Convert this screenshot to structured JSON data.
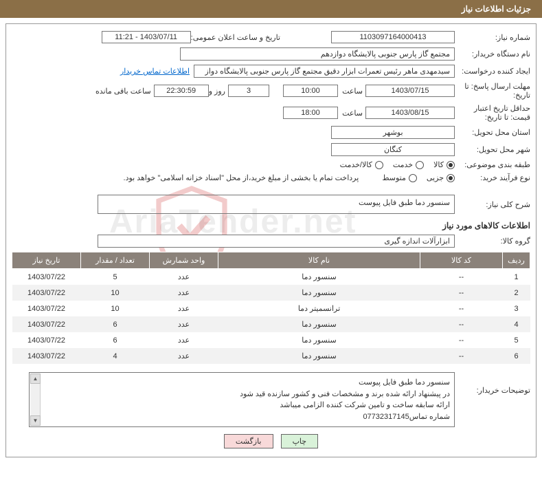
{
  "header": {
    "title": "جزئیات اطلاعات نیاز"
  },
  "labels": {
    "need_no": "شماره نیاز:",
    "announce_date": "تاریخ و ساعت اعلان عمومی:",
    "buyer_name": "نام دستگاه خریدار:",
    "requester": "ایجاد کننده درخواست:",
    "contact_link": "اطلاعات تماس خریدار",
    "response_deadline": "مهلت ارسال پاسخ: تا تاریخ:",
    "hour": "ساعت",
    "days_and": "روز و",
    "remaining": "ساعت باقی مانده",
    "min_valid": "حداقل تاریخ اعتبار قیمت: تا تاریخ:",
    "province": "استان محل تحویل:",
    "city": "شهر محل تحویل:",
    "classify": "طبقه بندی موضوعی:",
    "goods": "کالا",
    "service": "خدمت",
    "goods_service": "کالا/خدمت",
    "process": "نوع فرآیند خرید:",
    "partial": "جزیی",
    "medium": "متوسط",
    "payment_note": "پرداخت تمام یا بخشی از مبلغ خرید،از محل \"اسناد خزانه اسلامی\" خواهد بود.",
    "overall": "شرح کلی نیاز:",
    "goods_info": "اطلاعات کالاهای مورد نیاز",
    "group": "گروه کالا:",
    "buyer_desc": "توضیحات خریدار:",
    "print": "چاپ",
    "back": "بازگشت"
  },
  "values": {
    "need_no": "1103097164000413",
    "announce_date": "1403/07/11 - 11:21",
    "buyer_name": "مجتمع گاز پارس جنوبی  پالایشگاه دوازدهم",
    "requester": "سیدمهدی ماهر رئیس تعمرات ابزار دقیق مجتمع گاز پارس جنوبی  پالایشگاه دواز",
    "resp_date": "1403/07/15",
    "resp_time": "10:00",
    "days_left": "3",
    "clock_left": "22:30:59",
    "valid_date": "1403/08/15",
    "valid_time": "18:00",
    "province": "بوشهر",
    "city": "کنگان",
    "overall_text": "سنسور دما طبق فایل پیوست",
    "group_text": "ابزارآلات اندازه گیری"
  },
  "table": {
    "headers": {
      "row": "ردیف",
      "code": "کد کالا",
      "name": "نام کالا",
      "unit": "واحد شمارش",
      "qty": "تعداد / مقدار",
      "date": "تاریخ نیاز"
    },
    "rows": [
      {
        "no": "1",
        "code": "--",
        "name": "سنسور دما",
        "unit": "عدد",
        "qty": "5",
        "date": "1403/07/22"
      },
      {
        "no": "2",
        "code": "--",
        "name": "سنسور دما",
        "unit": "عدد",
        "qty": "10",
        "date": "1403/07/22"
      },
      {
        "no": "3",
        "code": "--",
        "name": "ترانسمیتر دما",
        "unit": "عدد",
        "qty": "10",
        "date": "1403/07/22"
      },
      {
        "no": "4",
        "code": "--",
        "name": "سنسور دما",
        "unit": "عدد",
        "qty": "6",
        "date": "1403/07/22"
      },
      {
        "no": "5",
        "code": "--",
        "name": "سنسور دما",
        "unit": "عدد",
        "qty": "6",
        "date": "1403/07/22"
      },
      {
        "no": "6",
        "code": "--",
        "name": "سنسور دما",
        "unit": "عدد",
        "qty": "4",
        "date": "1403/07/22"
      }
    ]
  },
  "comments": {
    "l1": "سنسور دما طبق فایل پیوست",
    "l2": "در پیشنهاد ارائه شده برند و مشخصات فنی و کشور سازنده قید شود",
    "l3": "ارائه سابقه ساخت و تامین شرکت کننده الزامی میباشد",
    "l4": "شماره تماس07732317145"
  },
  "watermark": "AriaTender.net"
}
